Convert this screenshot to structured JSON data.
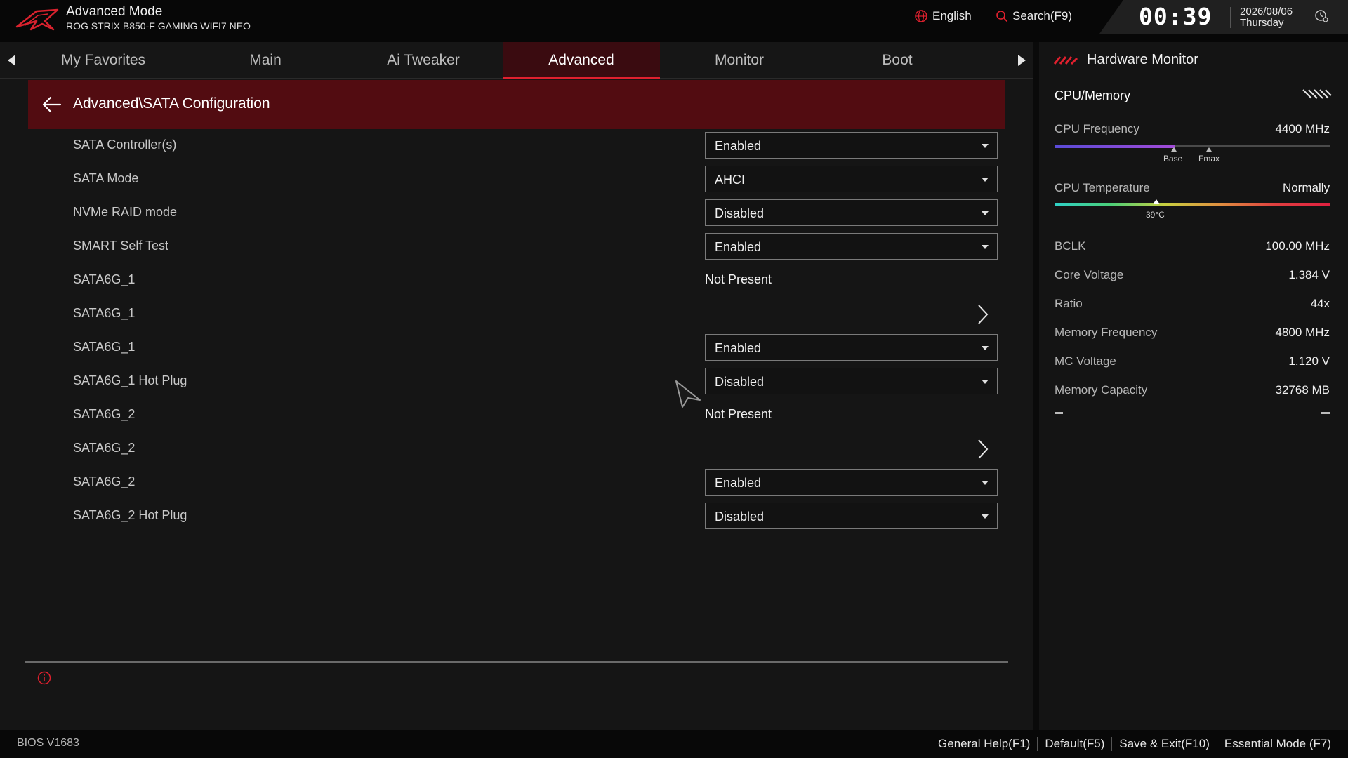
{
  "header": {
    "mode_title": "Advanced Mode",
    "board_name": "ROG STRIX B850-F GAMING WIFI7 NEO",
    "language": "English",
    "search": "Search(F9)",
    "clock": "00:39",
    "date": "2026/08/06",
    "weekday": "Thursday"
  },
  "nav": {
    "tabs": [
      {
        "label": "My Favorites"
      },
      {
        "label": "Main"
      },
      {
        "label": "Ai Tweaker"
      },
      {
        "label": "Advanced"
      },
      {
        "label": "Monitor"
      },
      {
        "label": "Boot"
      }
    ],
    "active_tab": "Advanced"
  },
  "breadcrumb": "Advanced\\SATA Configuration",
  "settings": [
    {
      "label": "SATA Controller(s)",
      "type": "dropdown",
      "value": "Enabled"
    },
    {
      "label": "SATA Mode",
      "type": "dropdown",
      "value": "AHCI"
    },
    {
      "label": "NVMe RAID mode",
      "type": "dropdown",
      "value": "Disabled"
    },
    {
      "label": "SMART Self Test",
      "type": "dropdown",
      "value": "Enabled"
    },
    {
      "label": "SATA6G_1",
      "type": "static",
      "value": "Not Present"
    },
    {
      "label": "SATA6G_1",
      "type": "submenu",
      "value": ""
    },
    {
      "label": "SATA6G_1",
      "type": "dropdown",
      "value": "Enabled"
    },
    {
      "label": "SATA6G_1 Hot Plug",
      "type": "dropdown",
      "value": "Disabled"
    },
    {
      "label": "SATA6G_2",
      "type": "static",
      "value": "Not Present"
    },
    {
      "label": "SATA6G_2",
      "type": "submenu",
      "value": ""
    },
    {
      "label": "SATA6G_2",
      "type": "dropdown",
      "value": "Enabled"
    },
    {
      "label": "SATA6G_2 Hot Plug",
      "type": "dropdown",
      "value": "Disabled"
    }
  ],
  "hardware_monitor": {
    "title": "Hardware Monitor",
    "section": "CPU/Memory",
    "cpu_frequency": {
      "label": "CPU Frequency",
      "value": "4400 MHz",
      "fill_fraction": 0.44,
      "base_label": "Base",
      "fmax_label": "Fmax"
    },
    "cpu_temperature": {
      "label": "CPU Temperature",
      "value": "Normally",
      "marker_fraction": 0.37,
      "marker_label": "39°C"
    },
    "stats": [
      {
        "label": "BCLK",
        "value": "100.00 MHz"
      },
      {
        "label": "Core Voltage",
        "value": "1.384 V"
      },
      {
        "label": "Ratio",
        "value": "44x"
      },
      {
        "label": "Memory Frequency",
        "value": "4800 MHz"
      },
      {
        "label": "MC Voltage",
        "value": "1.120 V"
      },
      {
        "label": "Memory Capacity",
        "value": "32768 MB"
      }
    ]
  },
  "footer": {
    "bios_version": "BIOS V1683",
    "keys": [
      {
        "label": "General Help(F1)"
      },
      {
        "label": "Default(F5)"
      },
      {
        "label": "Save & Exit(F10)"
      },
      {
        "label": "Essential Mode (F7)"
      }
    ]
  },
  "colors": {
    "accent": "#e0202e",
    "breadcrumb_bg": "#520c11",
    "active_tab_bg": "#3a0b10"
  }
}
